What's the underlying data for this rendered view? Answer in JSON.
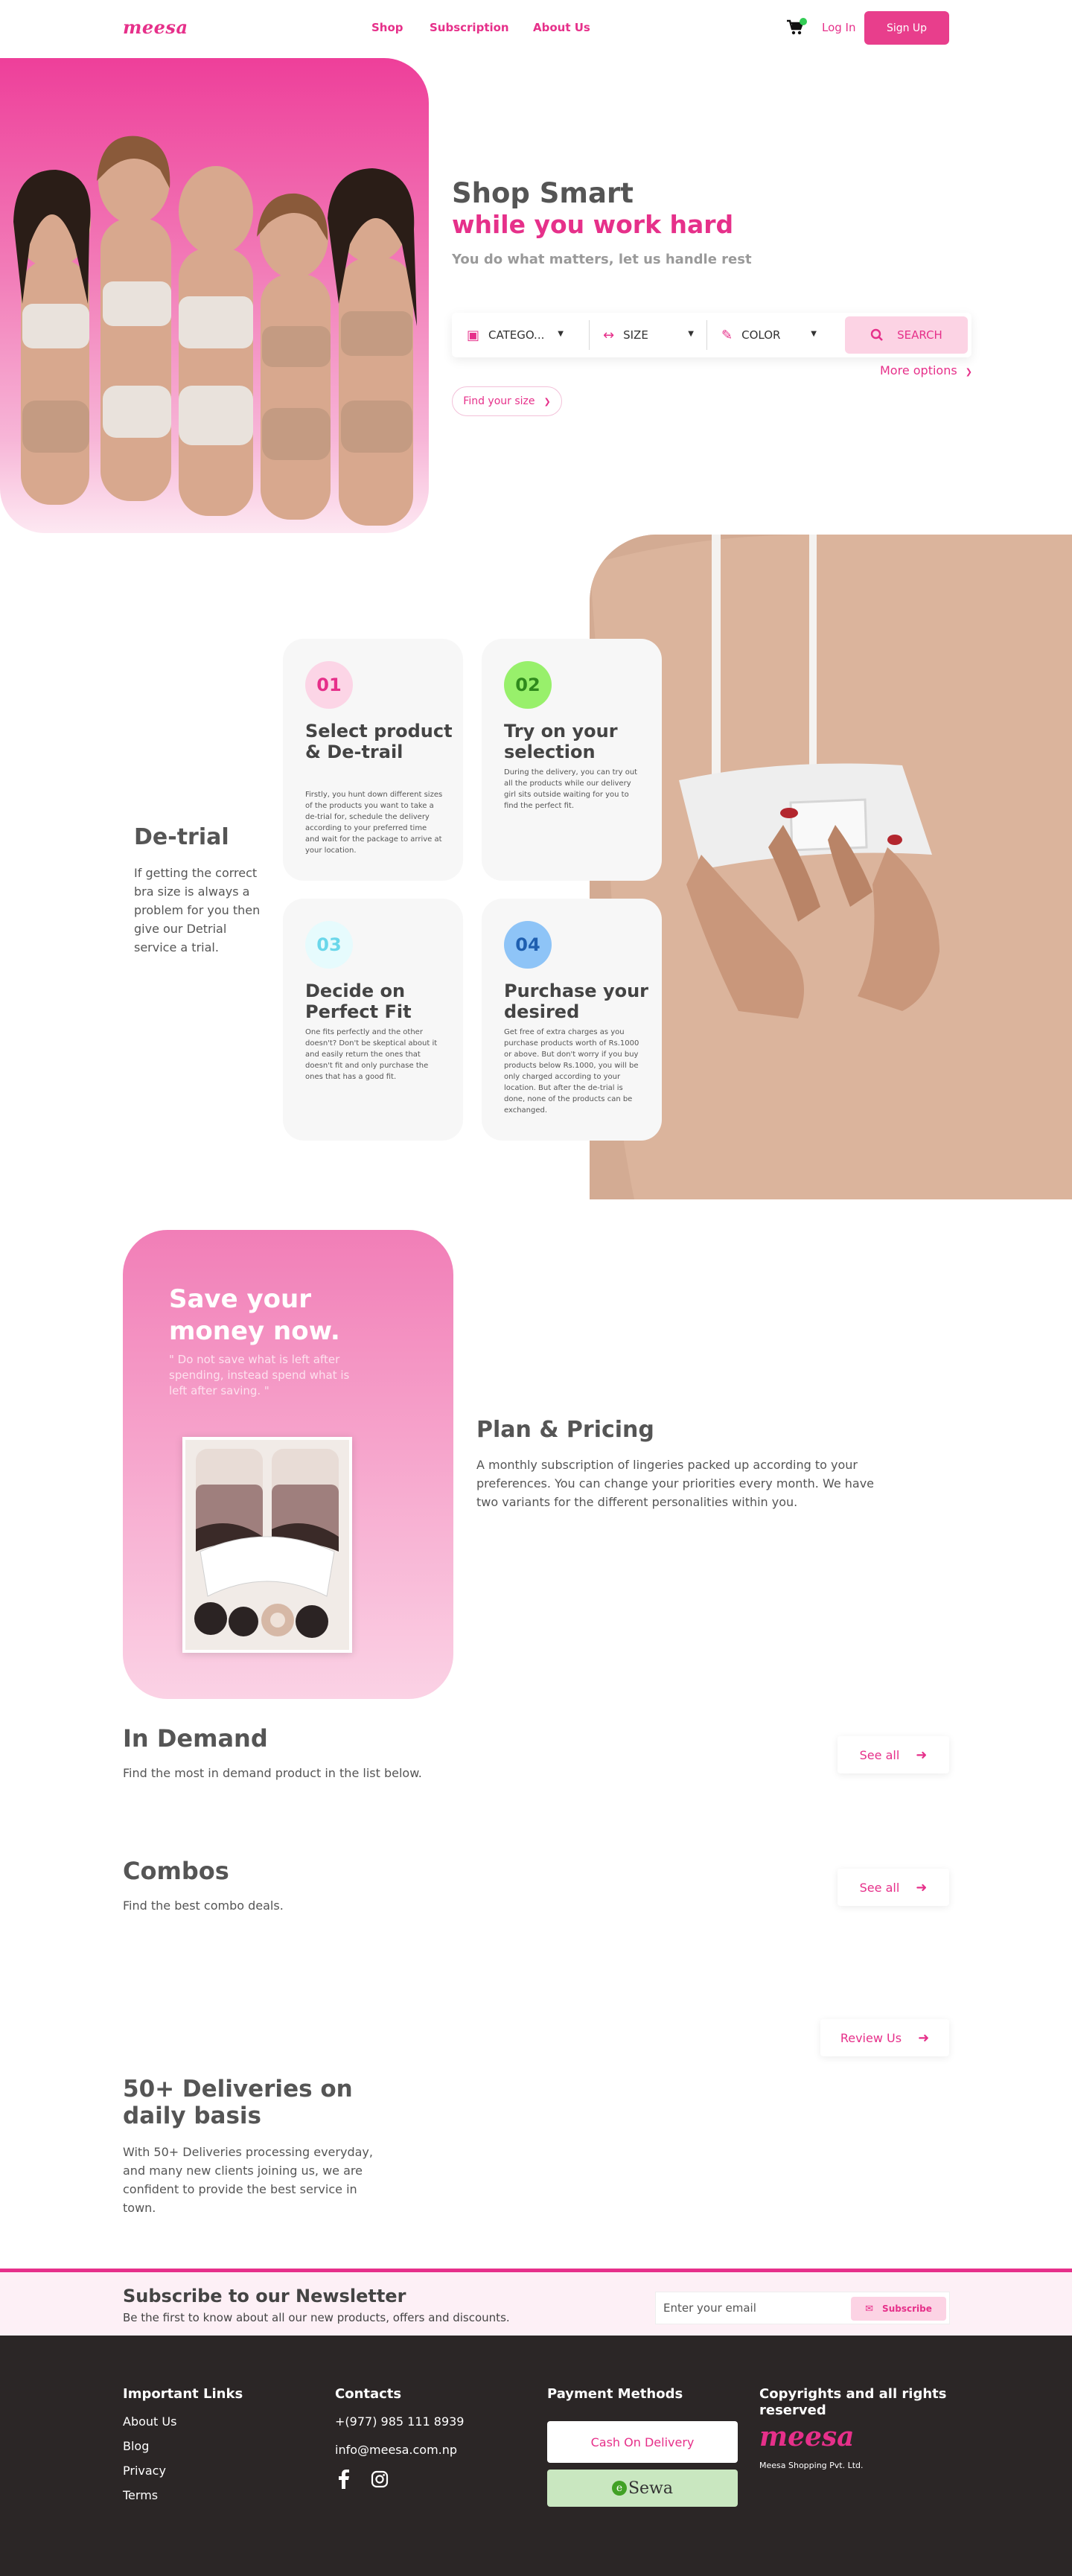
{
  "brand": {
    "logo": "meesa",
    "accent": "#e6308a"
  },
  "nav": {
    "links": [
      "Shop",
      "Subscription",
      "About Us"
    ],
    "login": "Log In",
    "signup": "Sign Up",
    "cart_icon": "cart-icon"
  },
  "hero": {
    "title": "Shop Smart",
    "title_accent": "while you work hard",
    "subtitle": "You do what matters, let us handle rest",
    "filters": [
      {
        "label": "CATEGO...",
        "icon": "basket-icon"
      },
      {
        "label": "SIZE",
        "icon": "size-arrows-icon"
      },
      {
        "label": "COLOR",
        "icon": "color-picker-icon"
      }
    ],
    "search_label": "SEARCH",
    "more_options": "More options",
    "find_size": "Find your size"
  },
  "detrial": {
    "title": "De-trial",
    "description": "If getting the correct bra size is always a problem for you then give our Detrial service a trial.",
    "steps": [
      {
        "num": "01",
        "title": "Select product & De-trail",
        "text": "Firstly, you hunt down different sizes of the products you want to take a de-trial for, schedule the delivery according to your preferred time and wait for the package to arrive at your location."
      },
      {
        "num": "02",
        "title": "Try on your selection",
        "text": "During the delivery, you can try out all the products while our delivery girl sits outside waiting for you to find the perfect fit."
      },
      {
        "num": "03",
        "title": "Decide on Perfect Fit",
        "text": "One fits perfectly and the other doesn't? Don't be skeptical about it and easily return the ones that doesn't fit and only purchase the ones that has a good fit."
      },
      {
        "num": "04",
        "title": "Purchase your desired",
        "text": "Get free of extra charges as you purchase products worth of Rs.1000 or above. But don't worry if you buy products below Rs.1000, you will be only charged according to your location. But after the de-trial is done, none of the products can be exchanged."
      }
    ]
  },
  "pricing": {
    "card_title": "Save your money now.",
    "card_quote": "\" Do not save what is left after spending, instead spend what is left after saving. \"",
    "title": "Plan & Pricing",
    "description": "A monthly subscription of lingeries packed up according to your preferences. You can change your priorities every month. We have two variants for the different personalities within you."
  },
  "in_demand": {
    "title": "In Demand",
    "description": "Find the most in demand product in the list below.",
    "button": "See all"
  },
  "combos": {
    "title": "Combos",
    "description": "Find the best combo deals.",
    "button": "See all"
  },
  "deliveries": {
    "title": "50+ Deliveries on daily basis",
    "description": "With 50+ Deliveries processing everyday, and many new clients joining us, we are confident to provide the best service in town.",
    "button": "Review Us"
  },
  "newsletter": {
    "title": "Subscribe to our Newsletter",
    "subtitle": "Be the first to know about all our new products, offers and discounts.",
    "placeholder": "Enter your email",
    "button": "Subscribe"
  },
  "footer": {
    "links_title": "Important Links",
    "links": [
      "About Us",
      "Blog",
      "Privacy",
      "Terms"
    ],
    "contacts_title": "Contacts",
    "phone": "+(977) 985 111 8939",
    "email": "info@meesa.com.np",
    "payment_title": "Payment Methods",
    "payment_cod": "Cash On Delivery",
    "payment_esewa": "Sewa",
    "copyright_title": "Copyrights and all rights reserved",
    "logo": "meesa",
    "company": "Meesa Shopping Pvt. Ltd."
  }
}
